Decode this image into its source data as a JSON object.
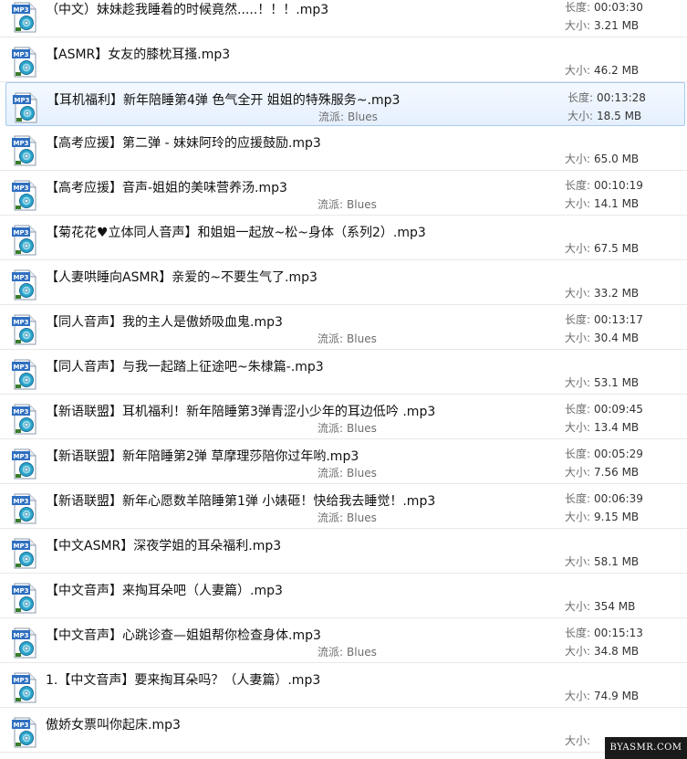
{
  "labels": {
    "duration": "长度:",
    "size": "大小:",
    "genre": "流派:"
  },
  "icon_text": "MP3",
  "watermark": "BYASMR.COM",
  "files": [
    {
      "name": "（中文）妹妹趁我睡着的时候竟然.....！！！.mp3",
      "genre": "",
      "duration": "00:03:30",
      "size": "3.21 MB",
      "selected": false
    },
    {
      "name": "【ASMR】女友的膝枕耳搔.mp3",
      "genre": "",
      "duration": "",
      "size": "46.2 MB",
      "selected": false
    },
    {
      "name": "【耳机福利】新年陪睡第4弹 色气全开 姐姐的特殊服务~.mp3",
      "genre": "Blues",
      "duration": "00:13:28",
      "size": "18.5 MB",
      "selected": true
    },
    {
      "name": "【高考应援】第二弹 - 妹妹阿玲的应援鼓励.mp3",
      "genre": "",
      "duration": "",
      "size": "65.0 MB",
      "selected": false
    },
    {
      "name": "【高考应援】音声-姐姐的美味营养汤.mp3",
      "genre": "Blues",
      "duration": "00:10:19",
      "size": "14.1 MB",
      "selected": false
    },
    {
      "name": "【菊花花♥立体同人音声】和姐姐一起放~松~身体（系列2）.mp3",
      "genre": "",
      "duration": "",
      "size": "67.5 MB",
      "selected": false
    },
    {
      "name": "【人妻哄睡向ASMR】亲爱的~不要生气了.mp3",
      "genre": "",
      "duration": "",
      "size": "33.2 MB",
      "selected": false
    },
    {
      "name": "【同人音声】我的主人是傲娇吸血鬼.mp3",
      "genre": "Blues",
      "duration": "00:13:17",
      "size": "30.4 MB",
      "selected": false
    },
    {
      "name": "【同人音声】与我一起踏上征途吧~朱棣篇-.mp3",
      "genre": "",
      "duration": "",
      "size": "53.1 MB",
      "selected": false
    },
    {
      "name": "【新语联盟】耳机福利！新年陪睡第3弹青涩小少年的耳边低吟 .mp3",
      "genre": "Blues",
      "duration": "00:09:45",
      "size": "13.4 MB",
      "selected": false
    },
    {
      "name": "【新语联盟】新年陪睡第2弹 草摩理莎陪你过年哟.mp3",
      "genre": "Blues",
      "duration": "00:05:29",
      "size": "7.56 MB",
      "selected": false
    },
    {
      "name": "【新语联盟】新年心愿数羊陪睡第1弹 小婊砸！快给我去睡觉！.mp3",
      "genre": "Blues",
      "duration": "00:06:39",
      "size": "9.15 MB",
      "selected": false
    },
    {
      "name": "【中文ASMR】深夜学姐的耳朵福利.mp3",
      "genre": "",
      "duration": "",
      "size": "58.1 MB",
      "selected": false
    },
    {
      "name": "【中文音声】来掏耳朵吧（人妻篇）.mp3",
      "genre": "",
      "duration": "",
      "size": "354 MB",
      "selected": false
    },
    {
      "name": "【中文音声】心跳诊查—姐姐帮你检查身体.mp3",
      "genre": "Blues",
      "duration": "00:15:13",
      "size": "34.8 MB",
      "selected": false
    },
    {
      "name": "1.【中文音声】要来掏耳朵吗？（人妻篇）.mp3",
      "genre": "",
      "duration": "",
      "size": "74.9 MB",
      "selected": false
    },
    {
      "name": "傲娇女票叫你起床.mp3",
      "genre": "",
      "duration": "",
      "size": "",
      "selected": false
    }
  ]
}
